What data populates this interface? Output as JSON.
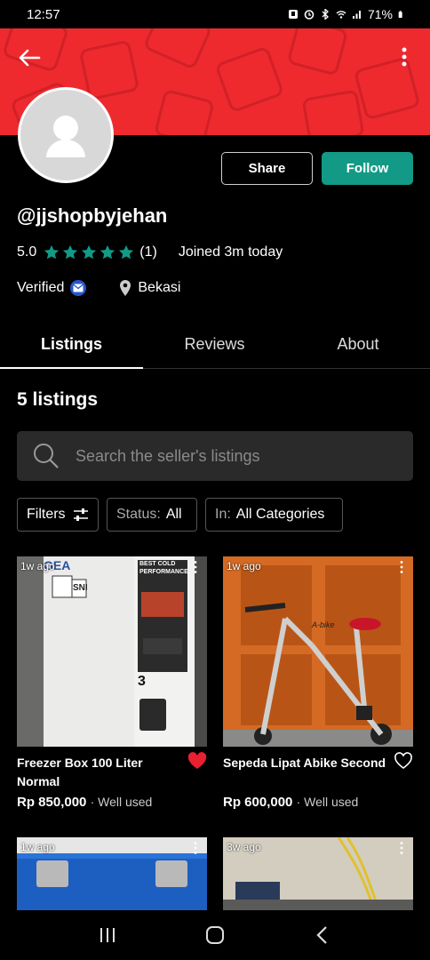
{
  "status_bar": {
    "time": "12:57",
    "battery": "71%"
  },
  "header": {
    "back_icon": "arrow-left-icon",
    "more_icon": "more-vertical-icon"
  },
  "profile": {
    "username": "@jjshopbyjehan",
    "rating": "5.0",
    "stars": 5,
    "review_count": "(1)",
    "joined": "Joined 3m today",
    "verified_label": "Verified",
    "location": "Bekasi",
    "share_label": "Share",
    "follow_label": "Follow",
    "accent_color": "#139a86",
    "banner_color": "#ee2a2f"
  },
  "tabs": [
    {
      "label": "Listings",
      "active": true
    },
    {
      "label": "Reviews",
      "active": false
    },
    {
      "label": "About",
      "active": false
    }
  ],
  "listings_header": "5 listings",
  "search": {
    "placeholder": "Search the seller's listings"
  },
  "filters": {
    "filters_label": "Filters",
    "status_label": "Status:",
    "status_value": "All",
    "in_label": "In:",
    "in_value": "All Categories"
  },
  "listings": [
    {
      "ago": "1w ago",
      "title": "Freezer Box 100 Liter Normal",
      "price": "Rp 850,000",
      "condition": "· Well used",
      "liked": true
    },
    {
      "ago": "1w ago",
      "title": "Sepeda Lipat Abike Second",
      "price": "Rp 600,000",
      "condition": "· Well used",
      "liked": false
    },
    {
      "ago": "1w ago"
    },
    {
      "ago": "3w ago"
    }
  ],
  "image_text": {
    "freezer_brand": "GEA",
    "freezer_tagline": "BEST COLD PERFORMANCE",
    "freezer_sni": "SNI",
    "freezer_number": "3",
    "bike_brand": "A-bike"
  }
}
